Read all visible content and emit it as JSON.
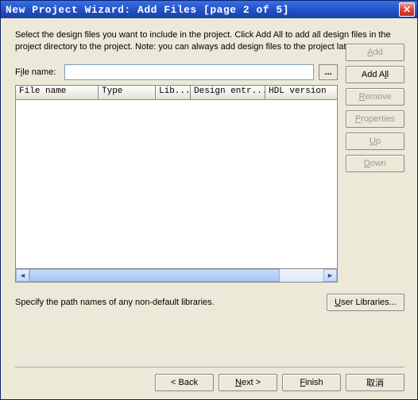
{
  "title": "New Project Wizard: Add Files [page 2 of 5]",
  "instructions": "Select the design files you want to include in the project. Click Add All to add all design files in the project directory to the project. Note: you can always add design files to the project later.",
  "file": {
    "label_pre": "F",
    "label_u": "i",
    "label_post": "le name:",
    "value": "",
    "browse": "..."
  },
  "columns": {
    "c0": "File name",
    "c1": "Type",
    "c2": "Lib...",
    "c3": "Design entr...",
    "c4": "HDL version"
  },
  "side": {
    "add_u": "A",
    "add_post": "dd",
    "addall_pre": "Add A",
    "addall_u": "l",
    "addall_post": "l",
    "remove_u": "R",
    "remove_post": "emove",
    "properties_u": "P",
    "properties_post": "roperties",
    "up_u": "U",
    "up_post": "p",
    "down_u": "D",
    "down_post": "own"
  },
  "lib": {
    "text": "Specify the path names of any non-default libraries.",
    "btn_pre": "",
    "btn_u": "U",
    "btn_post": "ser Libraries..."
  },
  "footer": {
    "back": "< Back",
    "next_u": "N",
    "next_post": "ext >",
    "finish_u": "F",
    "finish_post": "inish",
    "cancel": "取消"
  }
}
